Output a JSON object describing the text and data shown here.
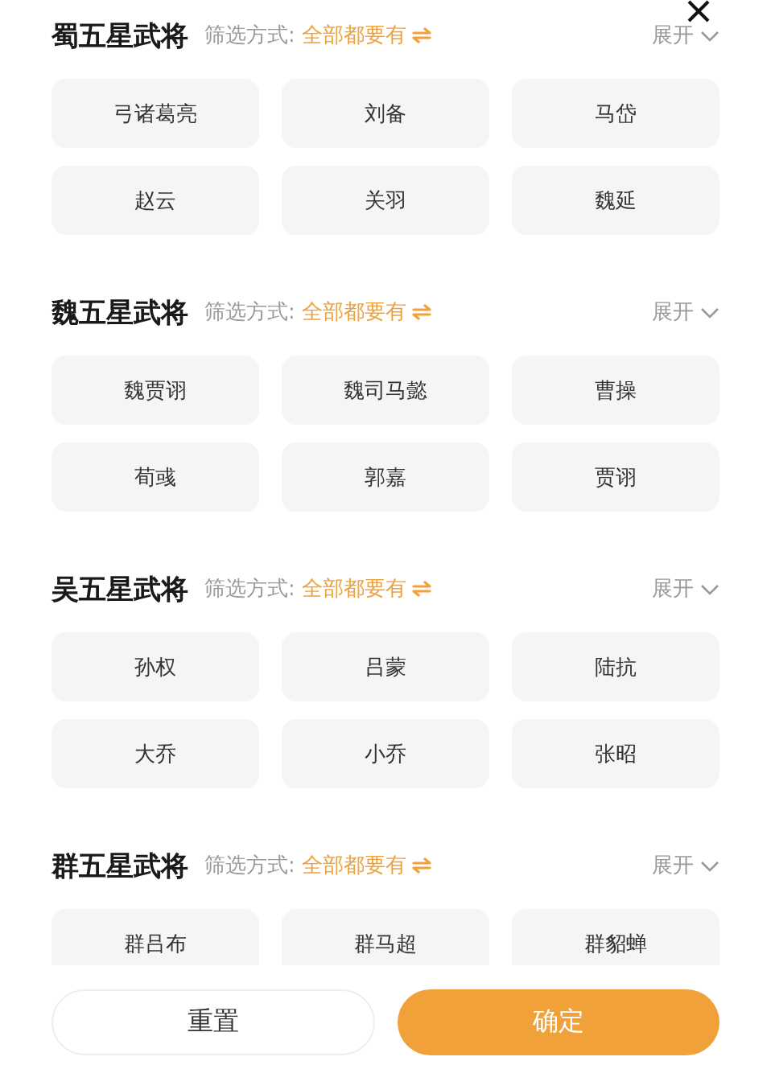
{
  "sections": [
    {
      "title": "蜀五星武将",
      "filter_label": "筛选方式:",
      "filter_value": "全部都要有",
      "expand_label": "展开",
      "items": [
        "弓诸葛亮",
        "刘备",
        "马岱",
        "赵云",
        "关羽",
        "魏延"
      ]
    },
    {
      "title": "魏五星武将",
      "filter_label": "筛选方式:",
      "filter_value": "全部都要有",
      "expand_label": "展开",
      "items": [
        "魏贾诩",
        "魏司马懿",
        "曹操",
        "荀彧",
        "郭嘉",
        "贾诩"
      ]
    },
    {
      "title": "吴五星武将",
      "filter_label": "筛选方式:",
      "filter_value": "全部都要有",
      "expand_label": "展开",
      "items": [
        "孙权",
        "吕蒙",
        "陆抗",
        "大乔",
        "小乔",
        "张昭"
      ]
    },
    {
      "title": "群五星武将",
      "filter_label": "筛选方式:",
      "filter_value": "全部都要有",
      "expand_label": "展开",
      "items": [
        "群吕布",
        "群马超",
        "群貂蝉"
      ]
    }
  ],
  "buttons": {
    "reset": "重置",
    "confirm": "确定"
  }
}
